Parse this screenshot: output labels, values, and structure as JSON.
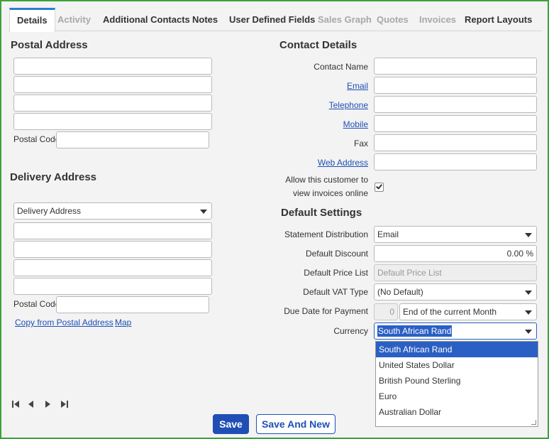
{
  "tabs": [
    {
      "label": "Details",
      "state": "active"
    },
    {
      "label": "Activity",
      "state": "disabled"
    },
    {
      "label": "Additional Contacts",
      "state": "enabled"
    },
    {
      "label": "Notes",
      "state": "enabled"
    },
    {
      "label": "User Defined Fields",
      "state": "enabled"
    },
    {
      "label": "Sales Graph",
      "state": "disabled"
    },
    {
      "label": "Quotes",
      "state": "disabled"
    },
    {
      "label": "Invoices",
      "state": "disabled"
    },
    {
      "label": "Report Layouts",
      "state": "enabled"
    }
  ],
  "postal": {
    "title": "Postal Address",
    "postal_code_label": "Postal Code"
  },
  "delivery": {
    "title": "Delivery Address",
    "select_value": "Delivery Address",
    "postal_code_label": "Postal Code",
    "copy_link": "Copy from Postal Address",
    "map_link": "Map"
  },
  "contact": {
    "title": "Contact Details",
    "contact_name_label": "Contact Name",
    "email_label": "Email",
    "telephone_label": "Telephone",
    "mobile_label": "Mobile",
    "fax_label": "Fax",
    "web_label": "Web Address",
    "allow_label_1": "Allow this customer to",
    "allow_label_2": "view invoices online",
    "allow_checked": true
  },
  "defaults": {
    "title": "Default Settings",
    "statement_label": "Statement Distribution",
    "statement_value": "Email",
    "discount_label": "Default Discount",
    "discount_value": "0.00 %",
    "price_list_label": "Default Price List",
    "price_list_placeholder": "Default Price List",
    "vat_label": "Default VAT Type",
    "vat_value": "(No Default)",
    "due_label": "Due Date for Payment",
    "due_days": "0",
    "due_value": "End of the current Month",
    "currency_label": "Currency",
    "currency_value": "South African Rand",
    "currency_options": [
      "South African Rand",
      "United States Dollar",
      "British Pound Sterling",
      "Euro",
      "Australian Dollar"
    ]
  },
  "buttons": {
    "save": "Save",
    "save_and_new": "Save And New"
  },
  "colors": {
    "accent": "#1f4fb5",
    "frame": "#3aa23a",
    "selection": "#2a5fc4"
  }
}
